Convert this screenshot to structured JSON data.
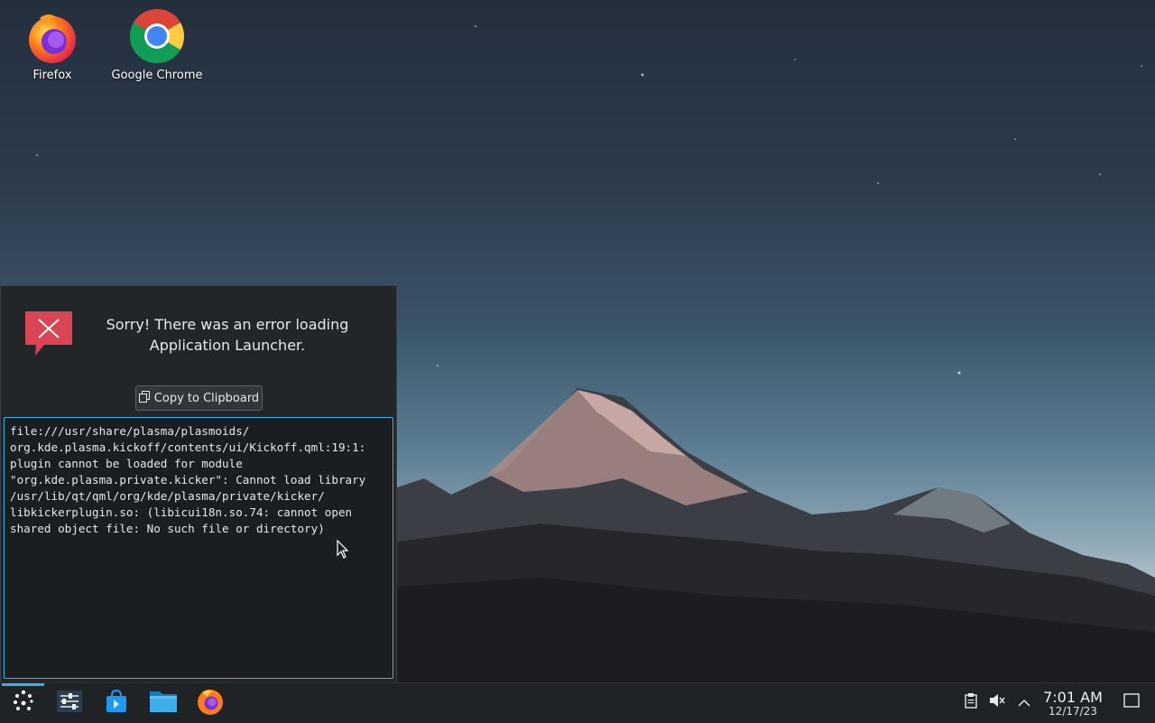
{
  "desktop": {
    "icons": [
      {
        "label": "Firefox"
      },
      {
        "label": "Google Chrome"
      }
    ]
  },
  "popup": {
    "message": "Sorry! There was an error loading Application Launcher.",
    "copy_button_label": "Copy to Clipboard",
    "log_text": "file:///usr/share/plasma/plasmoids/\norg.kde.plasma.kickoff/contents/ui/Kickoff.qml:19:1:\nplugin cannot be loaded for module\n\"org.kde.plasma.private.kicker\": Cannot load library\n/usr/lib/qt/qml/org/kde/plasma/private/kicker/\nlibkickerplugin.so: (libicui18n.so.74: cannot open\nshared object file: No such file or directory)"
  },
  "taskbar": {
    "items": [
      {
        "icon": "application-launcher-icon"
      },
      {
        "icon": "system-settings-icon"
      },
      {
        "icon": "discover-store-icon"
      },
      {
        "icon": "file-manager-icon"
      },
      {
        "icon": "firefox-icon"
      }
    ],
    "tray": [
      {
        "icon": "clipboard-icon"
      },
      {
        "icon": "volume-muted-icon"
      },
      {
        "icon": "chevron-up-icon"
      }
    ],
    "clock": {
      "time": "7:01 AM",
      "date": "12/17/23"
    },
    "show_desktop_icon": "show-desktop-icon"
  },
  "colors": {
    "accent": "#3daee9",
    "popup_bg": "#232629",
    "error_red": "#da4453"
  }
}
